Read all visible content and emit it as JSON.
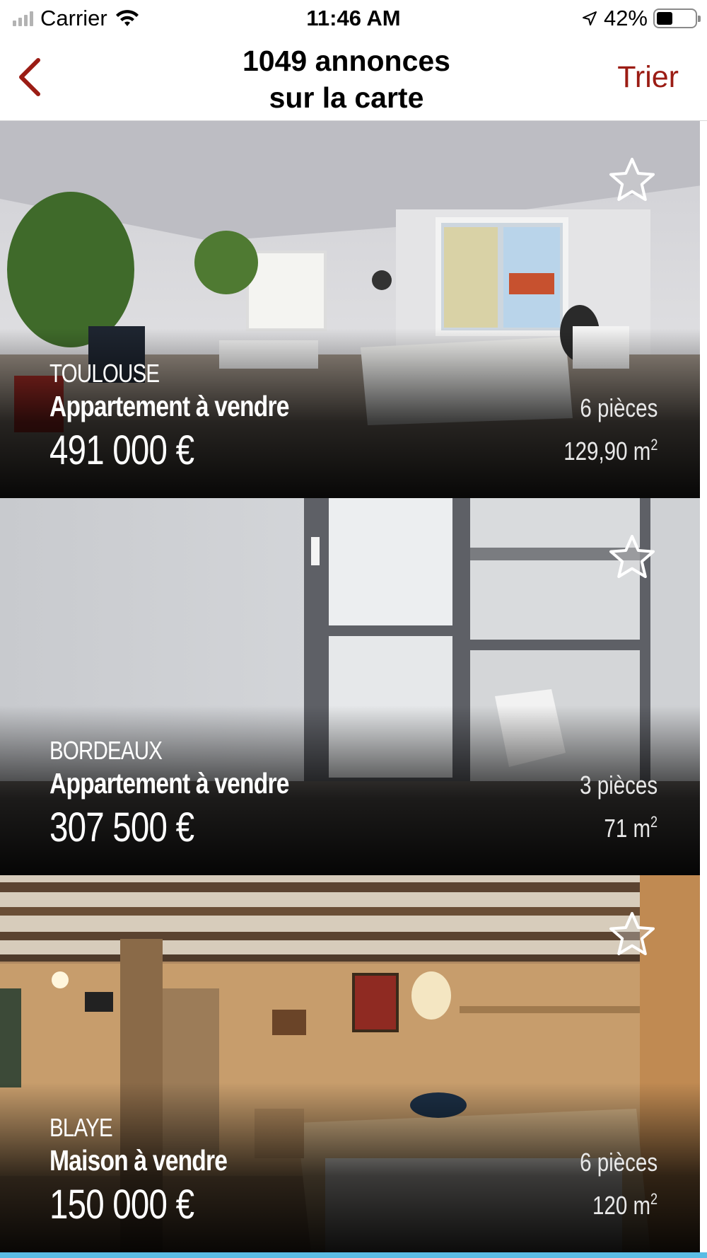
{
  "status_bar": {
    "carrier": "Carrier",
    "time": "11:46 AM",
    "battery_percent": "42%",
    "battery_level": 0.42
  },
  "nav": {
    "title_line1": "1049 annonces",
    "title_line2": "sur la carte",
    "sort_label": "Trier",
    "accent_color": "#9b1c14"
  },
  "listings": [
    {
      "city": "TOULOUSE",
      "type": "Appartement à vendre",
      "price": "491 000 €",
      "rooms": "6 pièces",
      "area": "129,90 m",
      "area_unit_sup": "2",
      "favorite": false
    },
    {
      "city": "BORDEAUX",
      "type": "Appartement à vendre",
      "price": "307 500 €",
      "rooms": "3 pièces",
      "area": "71 m",
      "area_unit_sup": "2",
      "favorite": false
    },
    {
      "city": "BLAYE",
      "type": "Maison à vendre",
      "price": "150 000 €",
      "rooms": "6 pièces",
      "area": "120 m",
      "area_unit_sup": "2",
      "favorite": false
    }
  ],
  "icons": {
    "back": "chevron-left-icon",
    "favorite": "star-outline-icon",
    "location": "location-arrow-icon",
    "wifi": "wifi-icon",
    "signal": "cellular-signal-icon",
    "battery": "battery-icon"
  }
}
